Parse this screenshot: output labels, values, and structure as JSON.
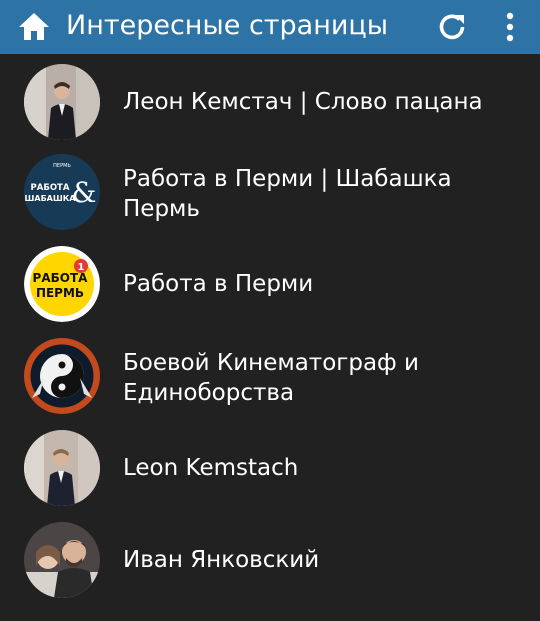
{
  "appbar": {
    "title": "Интересные страницы",
    "home_icon": "home-icon",
    "refresh_icon": "refresh-icon",
    "more_icon": "more-vertical-icon",
    "color": "#2e73a6"
  },
  "items": [
    {
      "label": "Леон Кемстач | Слово пацана",
      "avatar": "person-photo"
    },
    {
      "label": "Работа в Перми | Шабашка Пермь",
      "avatar": "logo",
      "logo_lines": [
        "РАБОТА",
        "ШАБАШКА"
      ],
      "logo_mark": "&",
      "logo_top": "ПЕРМЬ"
    },
    {
      "label": "Работа в Перми",
      "avatar": "logo",
      "logo_lines": [
        "РАБОТА",
        "ПЕРМЬ"
      ],
      "logo_badge": "1"
    },
    {
      "label": "Боевой Кинематограф и Единоборства",
      "avatar": "yin-yang-logo",
      "logo_ring_top": "БОЕВОЙ КИНЕМАТОГРАФ",
      "logo_ring_bottom": "ЕДИНОБОРСТВА"
    },
    {
      "label": "Leon Kemstach",
      "avatar": "person-photo"
    },
    {
      "label": "Иван Янковский",
      "avatar": "couple-photo"
    }
  ]
}
